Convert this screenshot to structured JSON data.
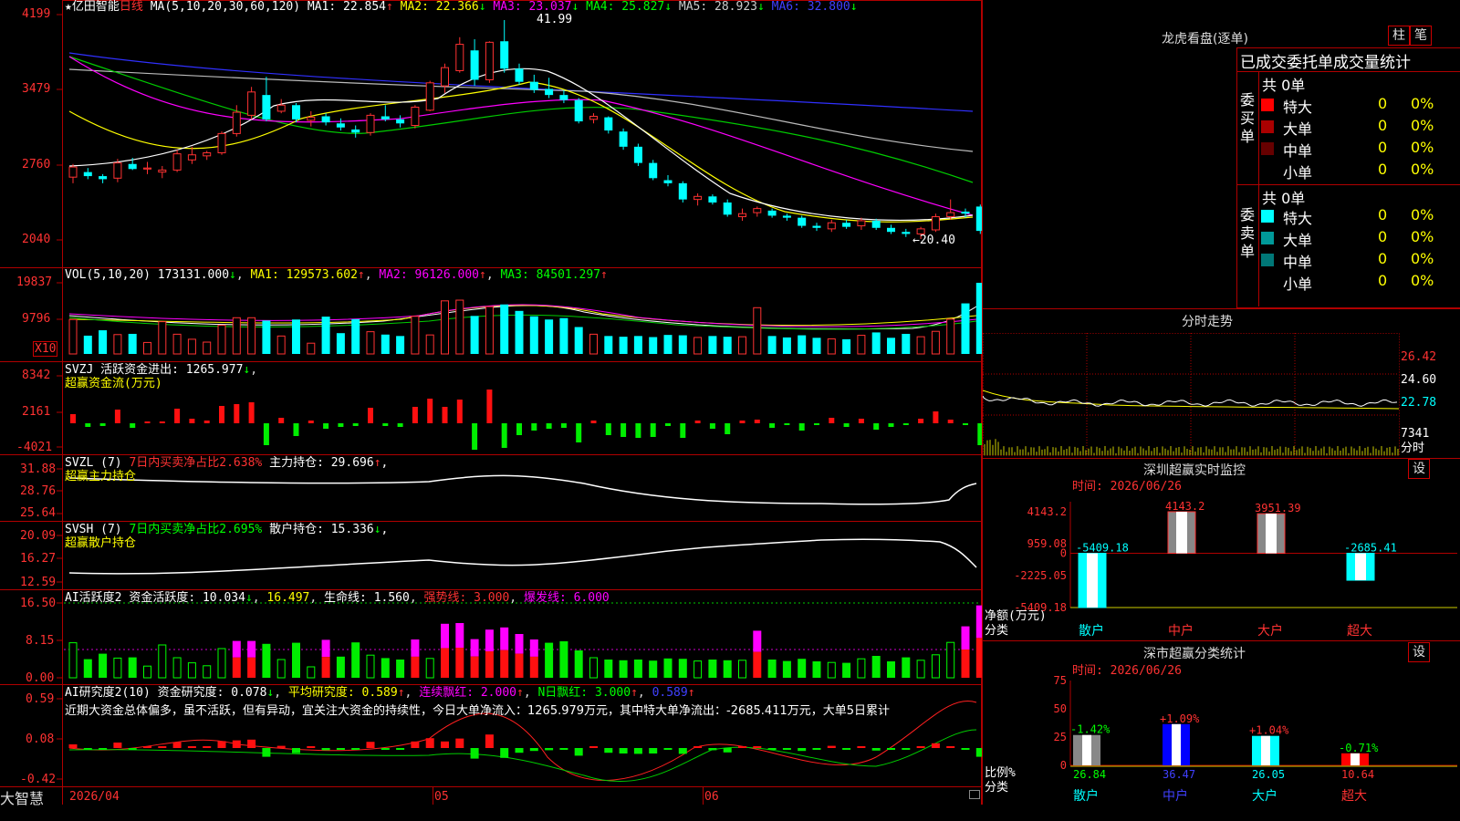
{
  "stock": {
    "star": "★",
    "name": "亿田智能",
    "period": "日线"
  },
  "ma_line": {
    "title": "MA(5,10,20,30,60,120)",
    "items": [
      {
        "label": "MA1:",
        "value": "22.854",
        "arrow": "↑",
        "color": "#ffffff"
      },
      {
        "label": "MA2:",
        "value": "22.366",
        "arrow": "↓",
        "color": "#ffff00"
      },
      {
        "label": "MA3:",
        "value": "23.037",
        "arrow": "↓",
        "color": "#ff00ff"
      },
      {
        "label": "MA4:",
        "value": "25.827",
        "arrow": "↓",
        "color": "#00ff00"
      },
      {
        "label": "MA5:",
        "value": "28.923",
        "arrow": "↓",
        "color": "#cccccc"
      },
      {
        "label": "MA6:",
        "value": "32.800",
        "arrow": "↓",
        "color": "#4040ff"
      }
    ]
  },
  "price_axis": [
    "4199",
    "3479",
    "2760",
    "2040"
  ],
  "price_marks": {
    "high": "41.99",
    "low": "←20.40"
  },
  "vol": {
    "title": "VOL(5,10,20)",
    "value": "173131.000",
    "arrow": "↓",
    "ma1": "MA1: 129573.602",
    "ma2": "MA2: 96126.000",
    "ma3": "MA3: 84501.297",
    "up": "↑",
    "axis": [
      "19837",
      "9796"
    ],
    "unit": "X10"
  },
  "svzj": {
    "title": "SVZJ",
    "label": "活跃资金进出: 1265.977",
    "arrow": "↓",
    "sub": "超赢资金流(万元)",
    "axis": [
      "8342",
      "2161",
      "-4021"
    ]
  },
  "svzl": {
    "title": "SVZL (7)",
    "label1": "7日内买卖净占比2.638%",
    "label2": "主力持仓: 29.696",
    "arrow": "↑",
    "tail": ",",
    "sub": "超赢主力持仓",
    "axis": [
      "31.88",
      "28.76",
      "25.64"
    ]
  },
  "svsh": {
    "title": "SVSH (7)",
    "label1": "7日内买卖净占比2.695%",
    "label2": "散户持仓: 15.336",
    "arrow": "↓",
    "tail": ",",
    "sub": "超赢散户持仓",
    "axis": [
      "20.09",
      "16.27",
      "12.59"
    ]
  },
  "ai_active": {
    "title": "AI活跃度2",
    "l1": "资金活跃度: 10.034",
    "a1": "↓",
    "l2": "16.497",
    "l3": "生命线: 1.560",
    "l4": "强势线: 3.000",
    "l5": "爆发线: 6.000",
    "axis": [
      "16.50",
      "8.15",
      "0.00"
    ]
  },
  "ai_research": {
    "title": "AI研究度2(10)",
    "l1": "资金研究度: 0.078",
    "a1": "↓",
    "l2": "平均研究度: 0.589",
    "a2": "↑",
    "l3": "连续飘红: 2.000",
    "a3": "↑",
    "l4": "N日飘红: 3.000",
    "a4": "↑",
    "l5": "0.589",
    "a5": "↑",
    "axis": [
      "0.59",
      "0.08",
      "-0.42"
    ],
    "comment": "近期大资金总体偏多，虽不活跃，但有异动，宜关注大资金的持续性，今日大单净流入：1265.979万元，其中特大单净流出：-2685.411万元，大单5日累计"
  },
  "bottom": {
    "brand": "大智慧",
    "date": "2026/04",
    "m1": "05",
    "m2": "06"
  },
  "longhu": {
    "title": "龙虎看盘(逐单)",
    "btn1": "柱",
    "btn2": "笔",
    "header": "已成交委托单成交量统计",
    "buy": {
      "side": "委买单",
      "total": "共 0单",
      "rows": [
        {
          "name": "特大",
          "v": "0",
          "p": "0%",
          "color": "#ff0000"
        },
        {
          "name": "大单",
          "v": "0",
          "p": "0%",
          "color": "#aa0000"
        },
        {
          "name": "中单",
          "v": "0",
          "p": "0%",
          "color": "#660000"
        },
        {
          "name": "小单",
          "v": "0",
          "p": "0%",
          "color": "#000000"
        }
      ]
    },
    "sell": {
      "side": "委卖单",
      "total": "共 0单",
      "rows": [
        {
          "name": "特大",
          "v": "0",
          "p": "0%",
          "color": "#00ffff"
        },
        {
          "name": "大单",
          "v": "0",
          "p": "0%",
          "color": "#009999"
        },
        {
          "name": "中单",
          "v": "0",
          "p": "0%",
          "color": "#007777"
        },
        {
          "name": "小单",
          "v": "0",
          "p": "0%",
          "color": "#000000"
        }
      ]
    }
  },
  "fenshi": {
    "title": "分时走势",
    "axis": [
      "26.42",
      "24.60",
      "22.78"
    ],
    "vol": "7341",
    "unit": "分时"
  },
  "sz_monitor": {
    "title": "深圳超赢实时监控",
    "btn": "设",
    "time": "时间: 2026/06/26",
    "axis": [
      "4143.2",
      "959.08",
      "0",
      "-2225.05",
      "-5409.18"
    ],
    "bars": [
      {
        "cat": "散户",
        "value": -5409.18,
        "label": "-5409.18"
      },
      {
        "cat": "中户",
        "value": 4143.2,
        "label": "4143.2"
      },
      {
        "cat": "大户",
        "value": 3951.39,
        "label": "3951.39"
      },
      {
        "cat": "超大",
        "value": -2685.41,
        "label": "-2685.41"
      }
    ],
    "ylabel": "净额(万元)",
    "xlabel": "分类"
  },
  "sz_class": {
    "title": "深市超赢分类统计",
    "btn": "设",
    "time": "时间: 2026/06/26",
    "axis": [
      "75",
      "50",
      "25",
      "0"
    ],
    "bars": [
      {
        "cat": "散户",
        "value": 26.84,
        "change": "-1.42%",
        "color": "#00ff00",
        "fill": "#888888"
      },
      {
        "cat": "中户",
        "value": 36.47,
        "change": "+1.09%",
        "color": "#ff3232",
        "fill": "#0000ff"
      },
      {
        "cat": "大户",
        "value": 26.05,
        "change": "+1.04%",
        "color": "#ff3232",
        "fill": "#00ffff"
      },
      {
        "cat": "超大",
        "value": 10.64,
        "change": "-0.71%",
        "color": "#00ff00",
        "fill": "#ff0000"
      }
    ],
    "ylabel": "比例%",
    "xlabel": "分类"
  },
  "chart_data": {
    "type": "candlestick",
    "ylim": [
      20.4,
      41.99
    ],
    "ohlc": [
      [
        26.5,
        27.8,
        25.9,
        27.5
      ],
      [
        27.0,
        27.4,
        26.3,
        26.6
      ],
      [
        26.6,
        26.8,
        25.9,
        26.3
      ],
      [
        26.4,
        28.3,
        26.0,
        27.9
      ],
      [
        27.8,
        28.4,
        27.2,
        27.3
      ],
      [
        27.3,
        28.0,
        26.8,
        27.4
      ],
      [
        27.0,
        27.6,
        26.4,
        27.2
      ],
      [
        27.2,
        29.2,
        27.0,
        28.8
      ],
      [
        28.2,
        29.5,
        27.8,
        28.7
      ],
      [
        28.6,
        29.1,
        28.2,
        28.9
      ],
      [
        28.9,
        31.0,
        28.7,
        30.8
      ],
      [
        30.8,
        33.6,
        30.5,
        32.9
      ],
      [
        32.6,
        35.4,
        32.2,
        34.9
      ],
      [
        34.6,
        36.4,
        32.0,
        32.2
      ],
      [
        33.0,
        34.2,
        32.8,
        33.6
      ],
      [
        33.6,
        33.8,
        31.9,
        32.2
      ],
      [
        32.1,
        33.0,
        31.5,
        32.4
      ],
      [
        32.5,
        32.8,
        31.6,
        31.9
      ],
      [
        31.8,
        32.3,
        31.1,
        31.4
      ],
      [
        31.2,
        31.6,
        30.4,
        30.9
      ],
      [
        30.9,
        32.8,
        30.6,
        32.6
      ],
      [
        32.5,
        33.6,
        32.0,
        32.2
      ],
      [
        32.2,
        32.6,
        31.4,
        31.8
      ],
      [
        31.6,
        33.6,
        31.3,
        33.4
      ],
      [
        33.1,
        36.0,
        33.0,
        35.8
      ],
      [
        35.5,
        37.7,
        34.8,
        37.3
      ],
      [
        37.0,
        40.3,
        36.8,
        39.6
      ],
      [
        39.0,
        40.1,
        35.5,
        36.1
      ],
      [
        36.1,
        39.9,
        35.8,
        39.8
      ],
      [
        39.9,
        41.99,
        36.8,
        37.2
      ],
      [
        37.2,
        37.7,
        35.6,
        35.9
      ],
      [
        35.9,
        36.6,
        34.8,
        35.1
      ],
      [
        35.2,
        36.3,
        34.3,
        34.6
      ],
      [
        34.6,
        35.1,
        33.8,
        34.1
      ],
      [
        34.1,
        34.3,
        31.8,
        32.0
      ],
      [
        32.2,
        32.8,
        31.8,
        32.5
      ],
      [
        32.4,
        32.5,
        30.8,
        31.1
      ],
      [
        31.0,
        31.3,
        29.2,
        29.5
      ],
      [
        29.5,
        29.8,
        27.6,
        27.9
      ],
      [
        27.9,
        28.2,
        26.2,
        26.4
      ],
      [
        26.2,
        26.7,
        25.6,
        25.9
      ],
      [
        25.9,
        26.1,
        24.0,
        24.3
      ],
      [
        24.3,
        24.9,
        23.7,
        24.6
      ],
      [
        24.6,
        24.8,
        23.8,
        24.0
      ],
      [
        24.0,
        24.3,
        22.6,
        22.8
      ],
      [
        22.6,
        23.4,
        22.2,
        22.9
      ],
      [
        23.0,
        23.6,
        22.6,
        23.4
      ],
      [
        23.2,
        23.4,
        22.5,
        22.7
      ],
      [
        22.7,
        22.9,
        22.2,
        22.5
      ],
      [
        22.5,
        22.7,
        21.5,
        21.7
      ],
      [
        21.7,
        22.0,
        21.2,
        21.5
      ],
      [
        21.4,
        22.3,
        21.1,
        22.0
      ],
      [
        22.0,
        22.3,
        21.4,
        21.6
      ],
      [
        21.7,
        22.5,
        21.3,
        22.2
      ],
      [
        22.2,
        22.4,
        21.3,
        21.5
      ],
      [
        21.5,
        21.8,
        20.9,
        21.1
      ],
      [
        21.1,
        21.4,
        20.6,
        20.9
      ],
      [
        20.9,
        21.6,
        20.4,
        21.4
      ],
      [
        21.3,
        22.9,
        21.1,
        22.6
      ],
      [
        22.6,
        24.3,
        22.3,
        23.0
      ],
      [
        23.1,
        23.4,
        22.5,
        22.9
      ],
      [
        23.6,
        23.8,
        20.9,
        21.2
      ]
    ],
    "volume": [
      9.6,
      5.1,
      6.6,
      5.4,
      5.6,
      3.2,
      9.0,
      5.5,
      4.1,
      3.3,
      8.0,
      10.1,
      10.1,
      9.3,
      5.0,
      9.6,
      3.0,
      10.4,
      5.8,
      9.7,
      6.2,
      5.4,
      5.0,
      10.5,
      5.3,
      14.8,
      15.0,
      10.6,
      13.2,
      13.8,
      12.0,
      10.5,
      9.6,
      10.0,
      7.5,
      5.5,
      5.0,
      4.8,
      5.0,
      4.7,
      5.3,
      5.2,
      4.6,
      5.0,
      4.8,
      4.8,
      12.9,
      5.0,
      4.6,
      5.2,
      4.5,
      4.2,
      4.1,
      5.2,
      6.0,
      4.5,
      5.6,
      4.8,
      6.3,
      9.7,
      14.1,
      19.84
    ]
  }
}
